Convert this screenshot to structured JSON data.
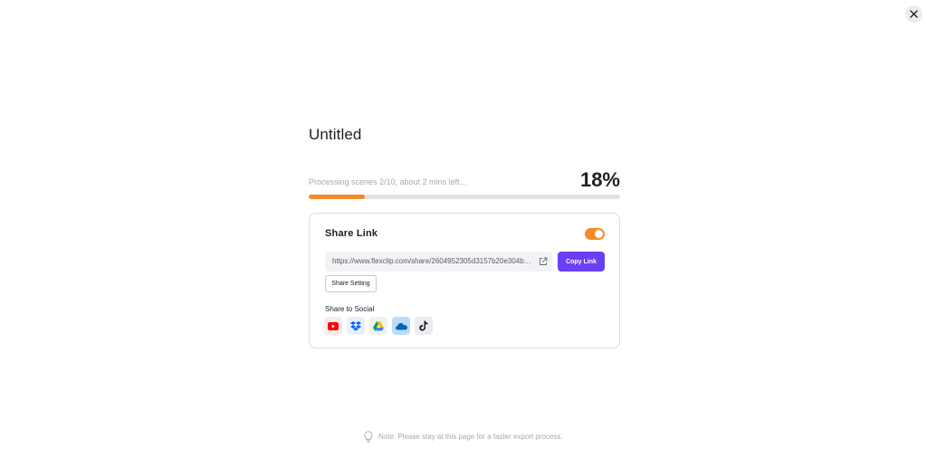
{
  "header": {
    "close_icon": "close-icon"
  },
  "project": {
    "title": "Untitled"
  },
  "progress": {
    "status_text": "Processing scenes 2/10, about 2 mins left...",
    "percent_text": "18%",
    "value": 0.18,
    "bar_color": "#f58a2a"
  },
  "share_link": {
    "title": "Share Link",
    "enabled": true,
    "url": "https://www.flexclip.com/share/2604952305d3157b20e304b25b...",
    "open_icon": "external-link-icon",
    "copy_label": "Copy Link",
    "setting_label": "Share Setting",
    "social_label": "Share to Social",
    "accent_color": "#6b3ff3",
    "toggle_color": "#f58a2a",
    "socials": [
      {
        "name": "YouTube",
        "icon": "youtube-icon"
      },
      {
        "name": "Dropbox",
        "icon": "dropbox-icon"
      },
      {
        "name": "Google Drive",
        "icon": "google-drive-icon"
      },
      {
        "name": "OneDrive",
        "icon": "onedrive-icon"
      },
      {
        "name": "TikTok",
        "icon": "tiktok-icon"
      }
    ]
  },
  "note": {
    "text": "Note: Please stay at this page for a faster export process.",
    "icon": "lightbulb-icon"
  }
}
